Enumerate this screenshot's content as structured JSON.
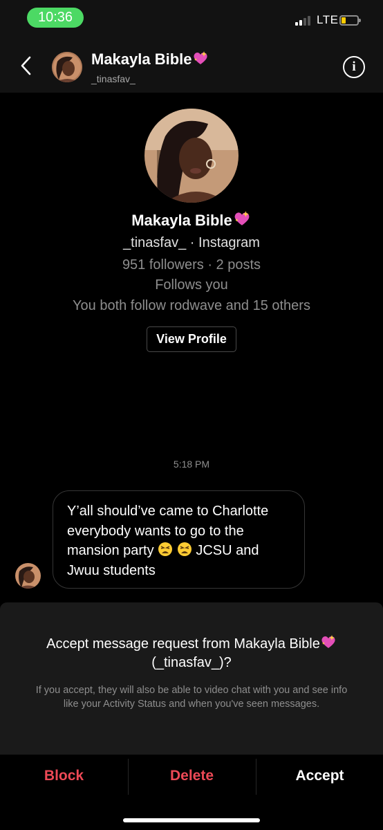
{
  "status_bar": {
    "time": "10:36",
    "network": "LTE",
    "time_pill_color": "#4cd964",
    "battery_color": "#ffcc00"
  },
  "header": {
    "name": "Makayla Bible",
    "username": "_tinasfav_",
    "back_icon": "chevron-left-icon",
    "info_icon": "info-icon"
  },
  "profile": {
    "name": "Makayla Bible",
    "name_emoji": "sparkling-heart",
    "handle_line": "_tinasfav_ · Instagram",
    "stats": "951 followers · 2 posts",
    "follows_you": "Follows you",
    "mutual": "You both follow rodwave and 15 others",
    "view_profile_label": "View Profile"
  },
  "thread": {
    "timestamp": "5:18 PM",
    "message": {
      "line1": "Y’all should’ve came to Charlotte",
      "line2": "everybody wants to go to the",
      "line3_before": "mansion party",
      "line3_emoji": "tired-face tired-face",
      "line3_after": "JCSU and",
      "line4": "Jwuu students"
    }
  },
  "request": {
    "title_line1": "Accept message request from Makayla Bible",
    "title_line2": "(_tinasfav_)?",
    "description": "If you accept, they will also be able to video chat with you and see info like your Activity Status and when you've seen messages."
  },
  "actions": {
    "block_label": "Block",
    "delete_label": "Delete",
    "accept_label": "Accept",
    "destructive_color": "#ed4956"
  }
}
